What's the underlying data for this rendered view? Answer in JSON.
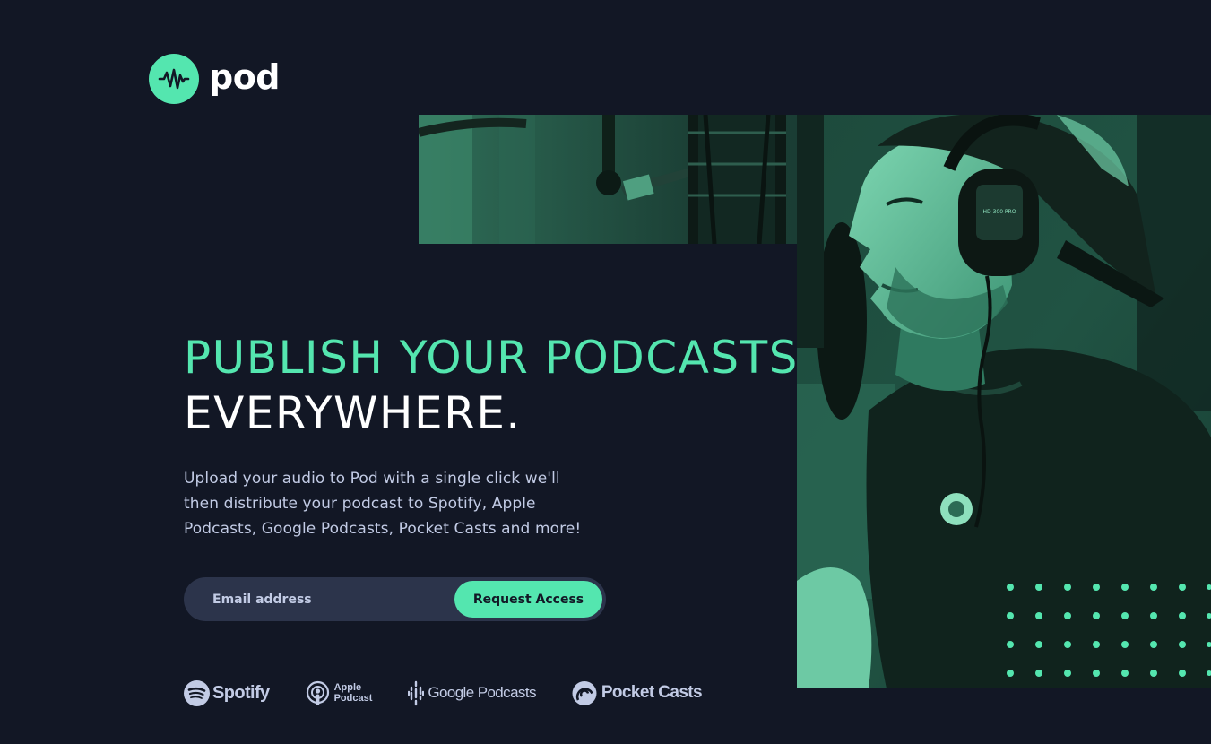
{
  "brand": {
    "name": "pod",
    "accent": "#54e6af",
    "background": "#121725"
  },
  "hero": {
    "headline_line1": "PUBLISH YOUR PODCASTS",
    "headline_line2": "EVERYWHERE.",
    "description": "Upload your audio to Pod with a single click we'll then distribute your podcast to Spotify, Apple Podcasts, Google Podcasts, Pocket Casts and more!"
  },
  "form": {
    "email_placeholder": "Email address",
    "email_value": "",
    "submit_label": "Request Access"
  },
  "platforms": {
    "spotify": "Spotify",
    "apple_line1": "Apple",
    "apple_line2": "Podcast",
    "google": "Google Podcasts",
    "pocket": "Pocket Casts"
  },
  "icons": [
    "logo-wave-icon",
    "spotify-icon",
    "apple-podcast-icon",
    "google-podcasts-icon",
    "pocket-casts-icon"
  ]
}
